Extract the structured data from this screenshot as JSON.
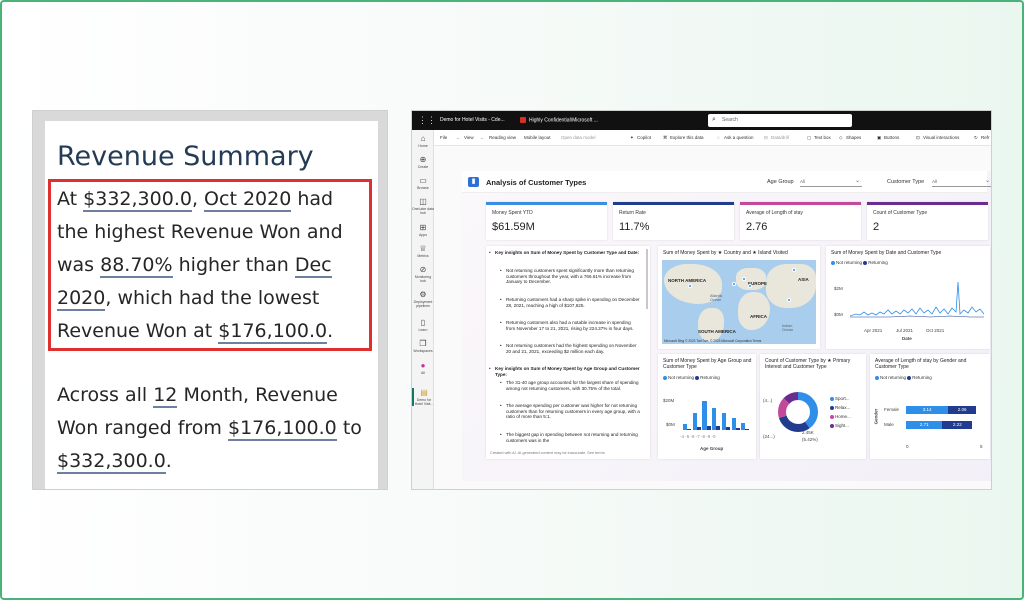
{
  "summary": {
    "title": "Revenue Summary",
    "p1": {
      "t1": "At ",
      "v1": "$332,300.0",
      "t2": ", ",
      "v2": "Oct 2020",
      "t3": " had the highest Revenue Won and was ",
      "v3": "88.70%",
      "t4": " higher than ",
      "v4": "Dec 2020",
      "t5": ", which had the lowest Revenue Won at ",
      "v5": "$176,100.0",
      "t6": "."
    },
    "p2": {
      "t1": "Across all ",
      "v1": "12",
      "t2": " Month, Revenue Won ranged from ",
      "v2": "$176,100.0",
      "t3": " to ",
      "v3": "$332,300.0",
      "t4": "."
    }
  },
  "topbar": {
    "app_title": "Demo for Hotel Visits - Cde...",
    "sensitivity": "Highly Confidential\\Microsoft ...",
    "search_placeholder": "Search"
  },
  "nav": [
    "Home",
    "Create",
    "Browse",
    "OneLake data hub",
    "Apps",
    "Metrics",
    "Monitoring hub",
    "Deployment pipelines",
    "Learn",
    "Workspaces",
    "All",
    "Demo for Hotel Visit..."
  ],
  "ribbon": {
    "file": "File",
    "view": "View",
    "reading_view": "Reading view",
    "mobile_layout": "Mobile layout",
    "open_data_model": "Open data model",
    "copilot": "Copilot",
    "explore": "Explore this data",
    "ask": "Ask a question",
    "data_drill": "Data/drill",
    "text_box": "Text box",
    "shapes": "Shapes",
    "buttons": "Buttons",
    "visual_interactions": "Visual interactions",
    "refresh": "Refr"
  },
  "report": {
    "title": "Analysis of Customer Types",
    "filters": [
      {
        "label": "Age Group",
        "value": "All"
      },
      {
        "label": "Customer Type",
        "value": "All"
      }
    ],
    "kpis": [
      {
        "label": "Money Spent YTD",
        "value": "$61.59M",
        "color": "#3a8de0"
      },
      {
        "label": "Return Rate",
        "value": "11.7%",
        "color": "#213b8f"
      },
      {
        "label": "Average of Length of stay",
        "value": "2.76",
        "color": "#c34a9b"
      },
      {
        "label": "Count of Customer Type",
        "value": "2",
        "color": "#6b2c8f"
      }
    ],
    "insights": {
      "h1": "Key insights on Sum of Money Spent by Customer Type and Date:",
      "b1": "Not returning customers spent significantly more than returning customers throughout the year, with a 766.61% increase from January to December.",
      "b2": "Returning customers had a sharp spike in spending on December 28, 2021, reaching a high of $107,625.",
      "b3": "Returning customers also had a notable increase in spending from November 17 to 21, 2021, rising by 224.37% in four days.",
      "b4": "Not returning customers had the highest spending on November 20 and 21, 2021, exceeding $2 million each day.",
      "h2": "Key insights on Sum of Money Spent by Age Group and Customer Type:",
      "b5": "The 31-40 age group accounted for the largest share of spending among not returning customers, with 30.75% of the total.",
      "b6": "The average spending per customer was higher for not returning customers than for returning customers in every age group, with a ratio of more than 5:1.",
      "b7": "The biggest gap in spending between not returning and returning customers was in the",
      "foot": "Created with AI. AI-generated content may be inaccurate. See terms"
    },
    "map": {
      "title": "Sum of Money Spent by ★ Country and ★ Island Visited",
      "labels": [
        "NORTH AMERICA",
        "EUROPE",
        "ASIA",
        "AFRICA",
        "SOUTH AMERICA"
      ],
      "oceans": [
        "Atlantic Ocean",
        "Indian Ocean"
      ],
      "footer": "Microsoft Bing © 2023 TomTom, © 2023 Microsoft Corporation Terms"
    },
    "date_chart": {
      "title": "Sum of Money Spent by Date and Customer Type",
      "legend": [
        "Not returning",
        "Returning"
      ],
      "yticks": [
        "$2M",
        "$0M"
      ],
      "xticks": [
        "Apr 2021",
        "Jul 2021",
        "Oct 2021"
      ],
      "xlabel": "Date"
    },
    "age_chart": {
      "title": "Sum of Money Spent by Age Group and Customer Type",
      "legend": [
        "Not returning",
        "Returning"
      ],
      "yticks": [
        "$20M",
        "$0M"
      ],
      "xlabel": "Age Group"
    },
    "donut": {
      "title": "Count of Customer Type by ★ Primary Interest and Customer Type",
      "labels_left": [
        "(4...)",
        "(24...)"
      ],
      "labels_right": [
        "2.45K",
        "(5.42%)"
      ],
      "legend": [
        "Sport...",
        "Relax...",
        "Home...",
        "Sight..."
      ]
    },
    "gender_chart": {
      "title": "Average of Length of stay by Gender and Customer Type",
      "legend": [
        "Not returning",
        "Returning"
      ],
      "rows": [
        {
          "label": "Female",
          "a": "3.14",
          "b": "2.06"
        },
        {
          "label": "Male",
          "a": "2.71",
          "b": "2.22"
        }
      ],
      "ylabel": "Gender",
      "xticks": [
        "0",
        "5"
      ]
    }
  },
  "chart_data": [
    {
      "type": "bar",
      "title": "Sum of Money Spent by Age Group and Customer Type",
      "xlabel": "Age Group",
      "ylabel": "",
      "categories": [
        "<21",
        "21-30",
        "31-40",
        "41-50",
        "51-60",
        "61-70",
        ">70"
      ],
      "series": [
        {
          "name": "Not returning",
          "values": [
            4,
            12,
            20,
            15,
            12,
            8,
            5
          ]
        },
        {
          "name": "Returning",
          "values": [
            0.8,
            2,
            3,
            2.5,
            2,
            1.5,
            1
          ]
        }
      ],
      "ylim": [
        0,
        25
      ]
    },
    {
      "type": "pie",
      "title": "Count of Customer Type by ★ Primary Interest and Customer Type",
      "categories": [
        "Sport...",
        "Relax...",
        "Home...",
        "Sight..."
      ],
      "values": [
        40,
        30,
        17,
        13
      ]
    },
    {
      "type": "bar",
      "title": "Average of Length of stay by Gender and Customer Type",
      "categories": [
        "Female",
        "Male"
      ],
      "series": [
        {
          "name": "Not returning",
          "values": [
            3.14,
            2.71
          ]
        },
        {
          "name": "Returning",
          "values": [
            2.06,
            2.22
          ]
        }
      ],
      "xlim": [
        0,
        5
      ]
    }
  ]
}
